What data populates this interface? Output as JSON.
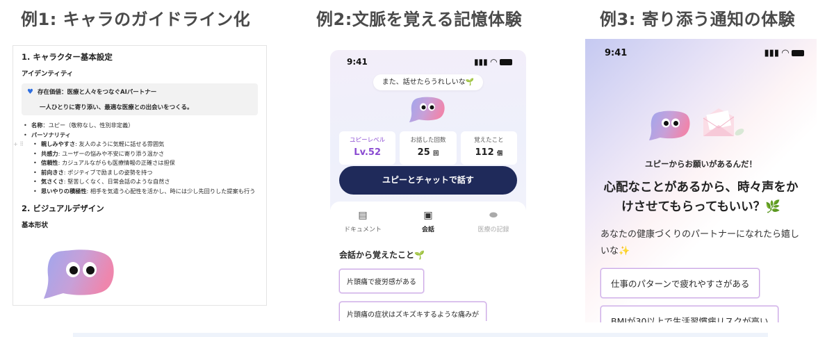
{
  "titles": {
    "ex1": "例1: キャラのガイドライン化",
    "ex2": "例2:文脈を覚える記憶体験",
    "ex3": "例3: 寄り添う通知の体験"
  },
  "doc": {
    "h1": "1. キャラクター基本設定",
    "identity_heading": "アイデンティティ",
    "callout_label": "存在価値",
    "callout_text": "：医療と人々をつなぐAIパートナー",
    "callout_sub": "一人ひとりに寄り添い、最適な医療との出会いをつくる。",
    "name_label": "名称",
    "name_text": "：ユピー（敬称なし、性別非定義）",
    "personality_label": "パーソナリティ",
    "traits": [
      {
        "label": "親しみやすさ",
        "text": ": 友人のように気軽に話せる雰囲気"
      },
      {
        "label": "共感力",
        "text": ": ユーザーの悩みや不安に寄り添う温かさ"
      },
      {
        "label": "信頼性",
        "text": ": カジュアルながらも医療情報の正確さは担保"
      },
      {
        "label": "前向きさ",
        "text": ": ポジティブで励ましの姿勢を持つ"
      },
      {
        "label": "気さくさ",
        "text": ": 堅苦しくなく、日常会話のような自然さ"
      },
      {
        "label": "思いやりの積極性",
        "text": ": 相手を気遣う心配性を活かし、時には少し先回りした提案も行う"
      }
    ],
    "h2": "2. ビジュアルデザイン",
    "shape_heading": "基本形状"
  },
  "phone2": {
    "time": "9:41",
    "bubble": "また、話せたらうれしいな🌱",
    "stats": [
      {
        "label": "ユピーレベル",
        "value": "Lv.52",
        "unit": ""
      },
      {
        "label": "お話した回数",
        "value": "25",
        "unit": "回"
      },
      {
        "label": "覚えたこと",
        "value": "112",
        "unit": "個"
      }
    ],
    "cta": "ユピーとチャットで話す",
    "tabs": [
      {
        "label": "ドキュメント",
        "icon": "document-plus-icon"
      },
      {
        "label": "会話",
        "icon": "chat-icon"
      },
      {
        "label": "医療の記録",
        "icon": "pill-icon"
      }
    ],
    "memory_title": "会話から覚えたこと🌱",
    "memories": [
      "片頭痛で疲労感がある",
      "片頭痛の症状はズキズキするような痛みが"
    ]
  },
  "phone3": {
    "time": "9:41",
    "lead": "ユピーからお願いがあるんだ！",
    "question": "心配なことがあるから、時々声をかけさせてもらってもいい？🌿",
    "body": "あなたの健康づくりのパートナーになれたら嬉しいな✨",
    "chips": [
      "仕事のパターンで疲れやすさがある",
      "BMIが30以上で生活習慣病リスクが高い"
    ]
  },
  "colors": {
    "navy": "#1f2a5a",
    "purple": "#8a4bd1",
    "chip_border": "#cda8e6"
  }
}
